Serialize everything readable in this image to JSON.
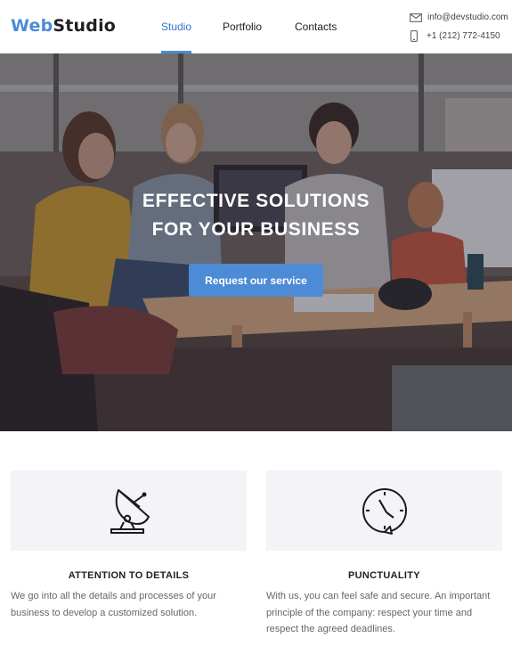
{
  "logo": {
    "part1": "Web",
    "part2": "Studio"
  },
  "nav": [
    {
      "label": "Studio",
      "active": true
    },
    {
      "label": "Portfolio",
      "active": false
    },
    {
      "label": "Contacts",
      "active": false
    }
  ],
  "contacts": {
    "email": "info@devstudio.com",
    "phone": "+1 (212) 772-4150",
    "email_icon": "mail-icon",
    "phone_icon": "phone-icon"
  },
  "hero": {
    "title_line1": "EFFECTIVE SOLUTIONS",
    "title_line2": "FOR YOUR BUSINESS",
    "button_label": "Request our service"
  },
  "features": [
    {
      "icon": "satellite-dish-icon",
      "title": "ATTENTION TO DETAILS",
      "text": "We go into all the details and processes of your business to develop a customized solution."
    },
    {
      "icon": "clock-icon",
      "title": "PUNCTUALITY",
      "text": "With us, you can feel safe and secure. An important principle of the company: respect your time and respect the agreed deadlines."
    }
  ],
  "colors": {
    "accent": "#4d8bd6",
    "text": "#212121",
    "muted": "#666666",
    "card_bg": "#f3f3f8"
  }
}
